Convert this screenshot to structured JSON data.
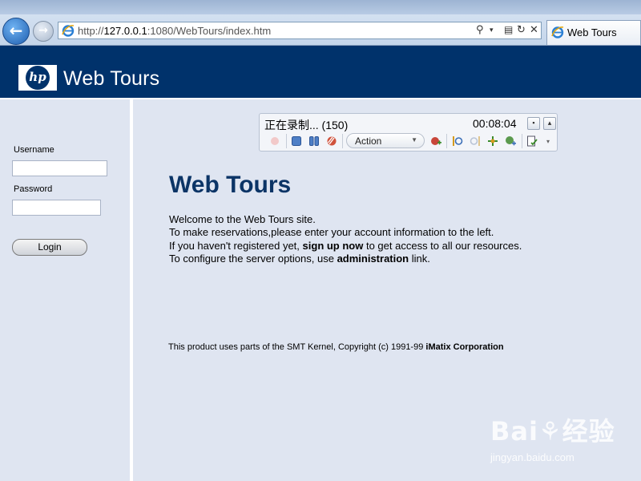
{
  "browser": {
    "url_prefix": "http://",
    "url_host": "127.0.0.1",
    "url_rest": ":1080/WebTours/index.htm",
    "tab_title": "Web Tours",
    "back_glyph": "←",
    "forward_glyph": "→"
  },
  "header": {
    "logo_text": "hp",
    "brand": "Web Tours"
  },
  "sidebar": {
    "username_label": "Username",
    "username_value": "",
    "password_label": "Password",
    "password_value": "",
    "login_label": "Login"
  },
  "main": {
    "heading": "Web Tours",
    "welcome_line1": "Welcome to the Web Tours site.",
    "welcome_line2": "To make reservations,please enter your account information to the left.",
    "welcome_line3_pre": "If you haven't registered yet, ",
    "signup_link": "sign up now",
    "welcome_line3_post": " to get access to all our resources.",
    "welcome_line4_pre": "To configure the server options, use ",
    "admin_link": "administration",
    "welcome_line4_post": " link.",
    "footer_pre": "This product uses parts of the SMT Kernel, Copyright (c) 1991-99 ",
    "footer_company": "iMatix Corporation"
  },
  "recorder": {
    "status": "正在录制... (150)",
    "elapsed": "00:08:04",
    "action_label": "Action",
    "icons": [
      "record-icon",
      "stop-icon",
      "pause-icon",
      "cancel-recording-icon",
      "insert-action-icon",
      "insert-start-transaction-icon",
      "insert-end-transaction-icon",
      "insert-rendezvous-icon",
      "insert-comment-icon",
      "insert-text-check-icon"
    ]
  },
  "watermark": {
    "logo": "Bai⚘经验",
    "site": "jingyan.baidu.com"
  },
  "colors": {
    "header_bg": "#00326b",
    "page_bg": "#dfe5f1",
    "heading_text": "#0b3466"
  }
}
